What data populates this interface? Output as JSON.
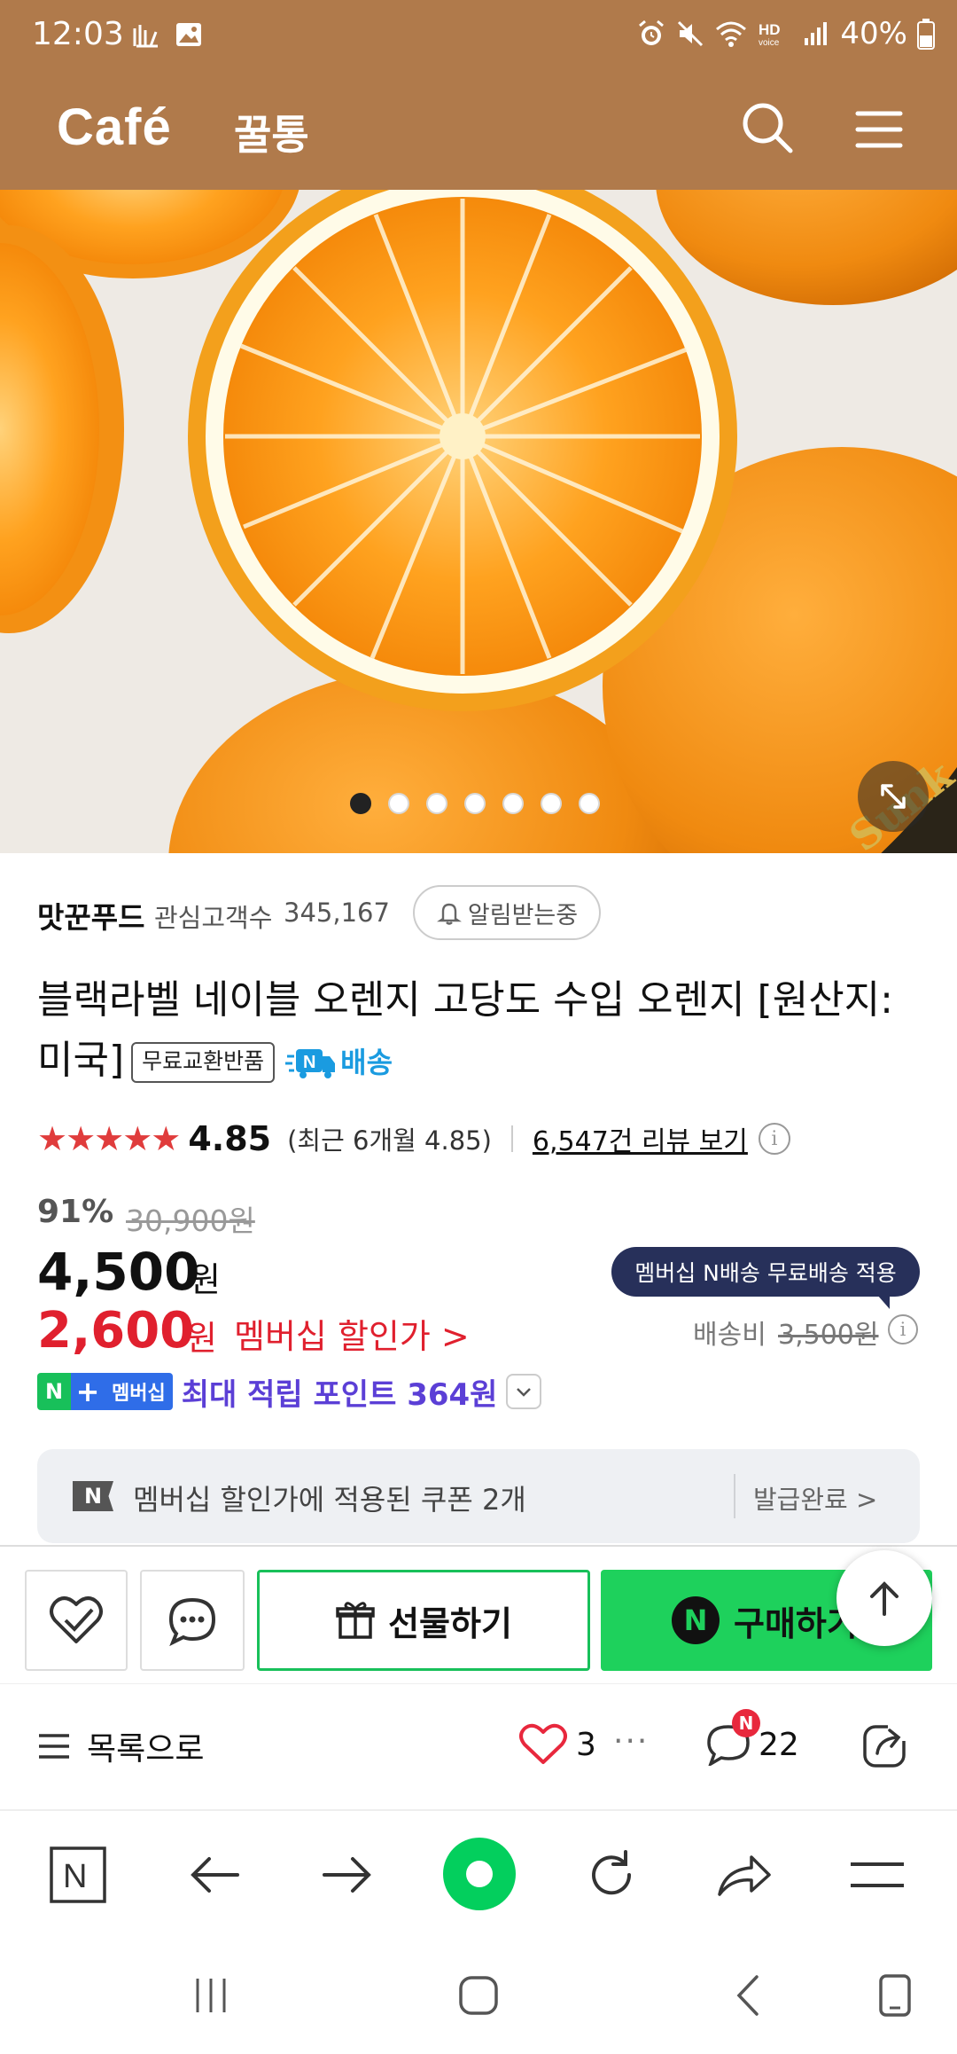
{
  "status_bar": {
    "time": "12:03",
    "battery": "40%",
    "icons": [
      "alarm-icon",
      "mute-icon",
      "wifi-icon",
      "hd-voice-icon",
      "signal-icon",
      "battery-icon"
    ]
  },
  "header": {
    "logo": "Café",
    "cafe_name": "꿀통",
    "icons": [
      "search-icon",
      "menu-icon"
    ]
  },
  "hero": {
    "image": "orange-photo",
    "slide_count": 7,
    "active_slide": 1
  },
  "seller": {
    "name": "맛꾼푸드",
    "followers_label": "관심고객수",
    "followers_count": "345,167",
    "alert_label": "알림받는중"
  },
  "product": {
    "title": "블랙라벨 네이블 오렌지 고당도 수입 오렌지 [원산지: 미국]",
    "badge_free_return": "무료교환반품",
    "badge_delivery": "배송"
  },
  "rating": {
    "stars": "★★★★★",
    "score": "4.85",
    "recent": "(최근 6개월 4.85)",
    "review_link": "6,547건 리뷰 보기",
    "info": "i"
  },
  "price": {
    "discount_rate": "91%",
    "original": "30,900원",
    "sale": "4,500",
    "unit": "원",
    "member": "2,600",
    "member_unit": "원",
    "member_label": "멤버십 할인가 >",
    "shipping_bubble": "멤버십 N배송 무료배송 적용",
    "shipping_label": "배송비",
    "shipping_price": "3,500원"
  },
  "points": {
    "badge_n": "N",
    "badge_plus": "+",
    "badge_member": "멤버십",
    "text": "최대 적립 포인트 364원"
  },
  "coupon": {
    "icon": "N",
    "text": "멤버십 할인가에 적용된 쿠폰 2개",
    "status": "발급완료 >"
  },
  "actions": {
    "gift_label": "선물하기",
    "buy_label": "구매하기",
    "buy_icon": "N"
  },
  "post_toolbar": {
    "list_label": "목록으로",
    "like_count": "3",
    "more": "···",
    "comment_count": "22",
    "new_badge": "N"
  },
  "browser_bar": {
    "home_label": "N"
  },
  "colors": {
    "header_bg": "#b07a4b",
    "accent_green": "#1ed15c",
    "price_red": "#e0202e",
    "points_purple": "#5b3fd6",
    "bubble_navy": "#27305a"
  }
}
